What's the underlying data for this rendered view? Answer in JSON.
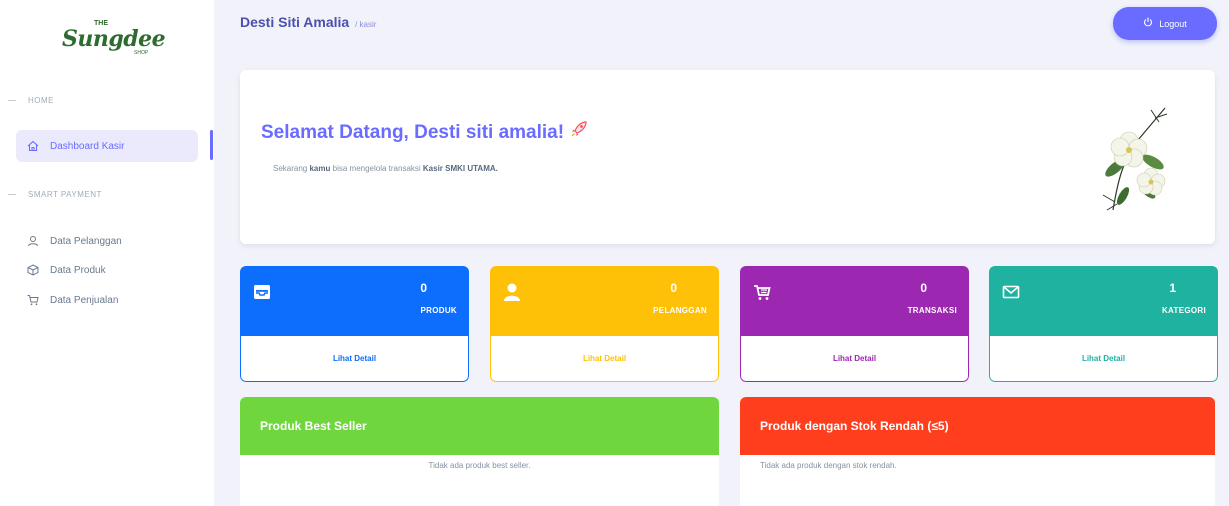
{
  "sidebar": {
    "logo": {
      "the": "THE",
      "script": "Sungdee",
      "shop": "SHOP"
    },
    "sections": [
      {
        "header": "HOME"
      },
      {
        "header": "SMART PAYMENT"
      }
    ],
    "items": [
      {
        "label": "Dashboard Kasir",
        "icon": "home-icon",
        "active": true
      },
      {
        "label": "Data Pelanggan",
        "icon": "user-icon",
        "active": false
      },
      {
        "label": "Data Produk",
        "icon": "box-icon",
        "active": false
      },
      {
        "label": "Data Penjualan",
        "icon": "cart-icon",
        "active": false
      }
    ]
  },
  "header": {
    "user_name": "Desti Siti Amalia",
    "user_role": "/ kasir",
    "logout_label": "Logout"
  },
  "welcome": {
    "title": "Selamat Datang, Desti siti amalia!",
    "text_before": "Sekarang",
    "text_bold_1": "kamu",
    "text_middle": "bisa mengelola transaksi",
    "text_bold_2": "Kasir SMKI UTAMA."
  },
  "stats": [
    {
      "count": "0",
      "label": "PRODUK",
      "link": "Lihat Detail",
      "color": "#0d6efd",
      "icon": "inbox-icon"
    },
    {
      "count": "0",
      "label": "PELANGGAN",
      "link": "Lihat Detail",
      "color": "#ffc107",
      "icon": "user-icon"
    },
    {
      "count": "0",
      "label": "TRANSAKSI",
      "link": "Lihat Detail",
      "color": "#9c27b0",
      "icon": "cart-icon"
    },
    {
      "count": "1",
      "label": "KATEGORI",
      "link": "Lihat Detail",
      "color": "#20b2a0",
      "icon": "envelope-icon"
    }
  ],
  "panels": [
    {
      "title": "Produk Best Seller",
      "empty_text": "Tidak ada produk best seller.",
      "color": "#6fd73d"
    },
    {
      "title": "Produk dengan Stok Rendah (≤5)",
      "empty_text": "Tidak ada produk dengan stok rendah.",
      "color": "#ff3e1d"
    }
  ]
}
